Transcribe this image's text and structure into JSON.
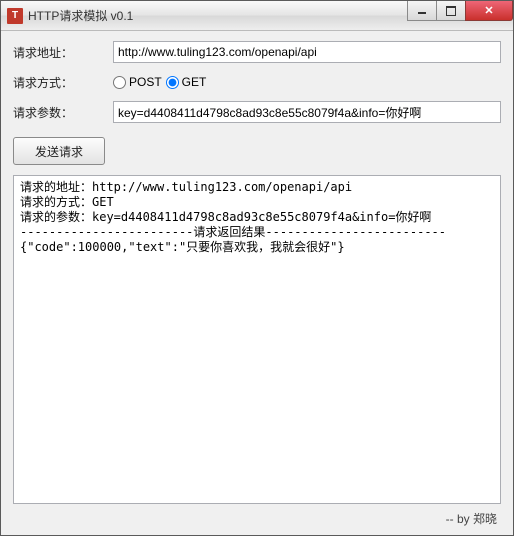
{
  "window": {
    "title": "HTTP请求模拟  v0.1",
    "icon_label": "T"
  },
  "form": {
    "url_label": "请求地址：",
    "url_value": "http://www.tuling123.com/openapi/api",
    "method_label": "请求方式：",
    "method_post": "POST",
    "method_get": "GET",
    "method_selected": "GET",
    "params_label": "请求参数：",
    "params_value": "key=d4408411d4798c8ad93c8e55c8079f4a&info=你好啊",
    "send_label": "发送请求"
  },
  "output": {
    "line1": "请求的地址：http://www.tuling123.com/openapi/api",
    "line2": "请求的方式：GET",
    "line3": "请求的参数：key=d4408411d4798c8ad93c8e55c8079f4a&info=你好啊",
    "divider": "------------------------请求返回结果-------------------------",
    "response": "{\"code\":100000,\"text\":\"只要你喜欢我，我就会很好\"}"
  },
  "footer": {
    "credit": "-- by 郑晓"
  }
}
